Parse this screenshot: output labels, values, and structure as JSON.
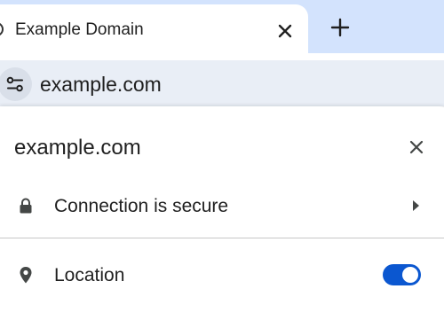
{
  "tab": {
    "title": "Example Domain",
    "favicon_icon": "globe-icon",
    "close_icon": "close-icon"
  },
  "tabstrip": {
    "new_tab_icon": "plus-icon"
  },
  "omnibox": {
    "site_settings_icon": "tune-icon",
    "url": "example.com"
  },
  "page_info": {
    "title": "example.com",
    "close_icon": "close-icon",
    "security": {
      "icon": "lock-icon",
      "label": "Connection is secure",
      "arrow_icon": "chevron-right-icon"
    },
    "location": {
      "icon": "location-pin-icon",
      "label": "Location",
      "enabled": true
    }
  },
  "colors": {
    "tabstrip_bg": "#d3e3fd",
    "omnibox_bg": "#e9eef6",
    "toggle_on": "#0b57d0",
    "text": "#1f1f1f"
  }
}
